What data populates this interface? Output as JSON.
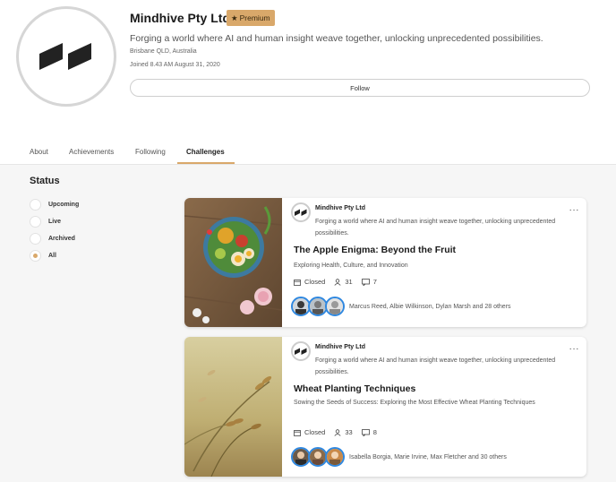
{
  "org": {
    "name": "Mindhive Pty Ltd",
    "badge": "Premium",
    "tagline": "Forging a world where AI and human insight weave together, unlocking unprecedented possibilities.",
    "location": "Brisbane QLD, Australia",
    "joined": "Joined 8.43 AM August 31, 2020",
    "follow_label": "Follow"
  },
  "tabs": [
    {
      "label": "About",
      "active": false
    },
    {
      "label": "Achievements",
      "active": false
    },
    {
      "label": "Following",
      "active": false
    },
    {
      "label": "Challenges",
      "active": true
    }
  ],
  "status": {
    "title": "Status",
    "options": [
      {
        "label": "Upcoming",
        "selected": false
      },
      {
        "label": "Live",
        "selected": false
      },
      {
        "label": "Archived",
        "selected": false
      },
      {
        "label": "All",
        "selected": true
      }
    ]
  },
  "cards": [
    {
      "org": "Mindhive Pty Ltd",
      "tagline": "Forging a world where AI and human insight weave together, unlocking unprecedented possibilities.",
      "title": "The Apple Enigma: Beyond the Fruit",
      "subtitle": "Exploring Health, Culture, and Innovation",
      "status": "Closed",
      "members": "31",
      "comments": "7",
      "participants": "Marcus Reed, Albie Wilkinson, Dylan Marsh and 28 others"
    },
    {
      "org": "Mindhive Pty Ltd",
      "tagline": "Forging a world where AI and human insight weave together, unlocking unprecedented possibilities.",
      "title": "Wheat Planting Techniques",
      "subtitle": "Sowing the Seeds of Success: Exploring the Most Effective Wheat Planting Techniques",
      "status": "Closed",
      "members": "33",
      "comments": "8",
      "participants": "Isabella Borgia, Marie Irvine, Max Fletcher and 30 others"
    }
  ],
  "colors": {
    "accent": "#d9a86a",
    "avatar_ring": "#2f88e0",
    "logo": "#222222"
  }
}
